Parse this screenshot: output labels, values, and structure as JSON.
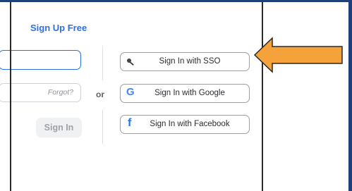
{
  "header": {
    "signup_label": "Sign Up Free"
  },
  "form": {
    "forgot_label": "Forgot?",
    "signin_label": "Sign In",
    "or_label": "or"
  },
  "sso": {
    "sso_label": "Sign In with SSO",
    "google_label": "Sign In with Google",
    "facebook_label": "Sign In with Facebook",
    "sso_icon": "key-icon",
    "google_icon": "google-icon",
    "facebook_icon": "facebook-icon"
  },
  "colors": {
    "accent": "#2d6fe3",
    "google_blue": "#4285f4",
    "facebook_blue": "#1877f2",
    "arrow_fill": "#f5a23a",
    "background": "#5b8ddb"
  }
}
